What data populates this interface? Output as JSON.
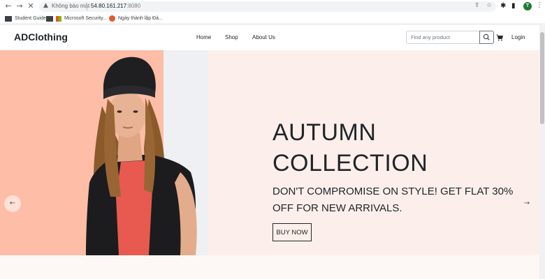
{
  "browser": {
    "security_label": "Không bảo mật",
    "url_host": "54.80.161.217",
    "url_port": ":8080",
    "profile_initial": "T",
    "bookmarks": [
      {
        "label": "Student Guide"
      },
      {
        "label": "Microsoft Security..."
      },
      {
        "label": "Ngày thành lập Đả..."
      }
    ]
  },
  "site": {
    "brand": "ADClothing",
    "nav": [
      {
        "label": "Home"
      },
      {
        "label": "Shop"
      },
      {
        "label": "About Us"
      }
    ],
    "search_placeholder": "Find any product",
    "login_label": "Login"
  },
  "hero": {
    "title_line1": "AUTUMN",
    "title_line2": "COLLECTION",
    "subtitle": "DON'T COMPROMISE ON STYLE! GET FLAT 30% OFF FOR NEW ARRIVALS.",
    "button_label": "BUY NOW",
    "colors": {
      "panel_salmon": "#fdbda6",
      "panel_grey": "#eef0f3",
      "background": "#fcefeb"
    }
  },
  "icons": {
    "back": "back-arrow-icon",
    "forward": "forward-arrow-icon",
    "stop": "close-icon",
    "search": "search-icon",
    "cart": "cart-icon",
    "prev": "arrow-left-icon",
    "next": "arrow-right-icon"
  }
}
